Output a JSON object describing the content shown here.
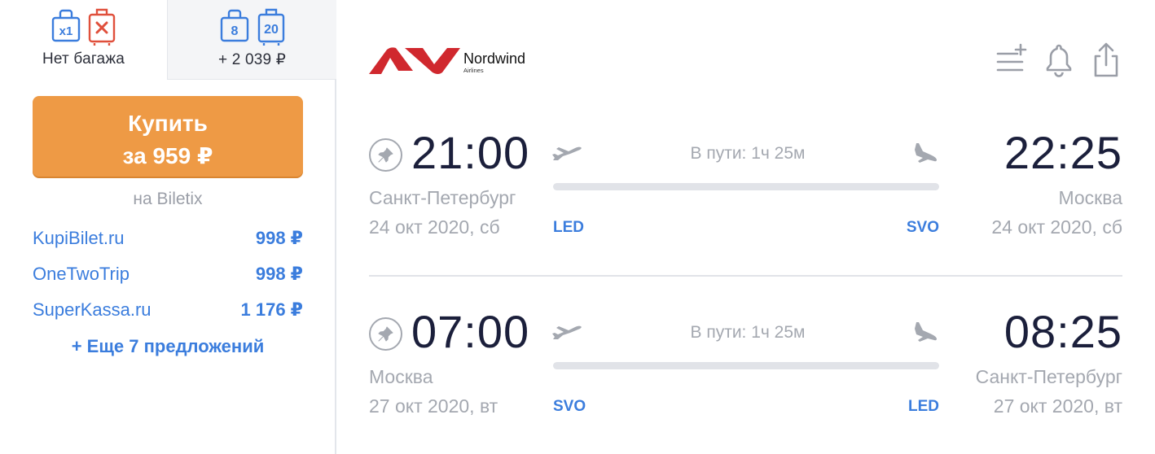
{
  "baggage_tabs": {
    "no_bag": {
      "carry_on": "x1",
      "label": "Нет багажа"
    },
    "with_bag": {
      "carry_on_kg": "8",
      "checked_kg": "20",
      "label": "+ 2 039 ₽"
    }
  },
  "buy": {
    "line1": "Купить",
    "line2": "за 959 ₽",
    "via": "на Biletix"
  },
  "offers": [
    {
      "name": "KupiBilet.ru",
      "price": "998 ₽"
    },
    {
      "name": "OneTwoTrip",
      "price": "998 ₽"
    },
    {
      "name": "SuperKassa.ru",
      "price": "1 176 ₽"
    }
  ],
  "more_offers": "+ Еще 7 предложений",
  "airline": {
    "name": "Nordwind",
    "sub": "Airlines",
    "brand_color": "#d0282e"
  },
  "top_icons": [
    "add-to-list-icon",
    "bell-icon",
    "share-icon"
  ],
  "segments": [
    {
      "dep_time": "21:00",
      "arr_time": "22:25",
      "duration": "В пути: 1ч 25м",
      "dep_city": "Санкт-Петербург",
      "arr_city": "Москва",
      "dep_date": "24 окт 2020, сб",
      "arr_date": "24 окт 2020, сб",
      "dep_code": "LED",
      "arr_code": "SVO"
    },
    {
      "dep_time": "07:00",
      "arr_time": "08:25",
      "duration": "В пути: 1ч 25м",
      "dep_city": "Москва",
      "arr_city": "Санкт-Петербург",
      "dep_date": "27 окт 2020, вт",
      "arr_date": "27 окт 2020, вт",
      "dep_code": "SVO",
      "arr_code": "LED"
    }
  ],
  "colors": {
    "accent_blue": "#3b7ddd",
    "buy_orange": "#ee9a45",
    "muted": "#a4a8b0",
    "alert_red": "#e0503c"
  }
}
